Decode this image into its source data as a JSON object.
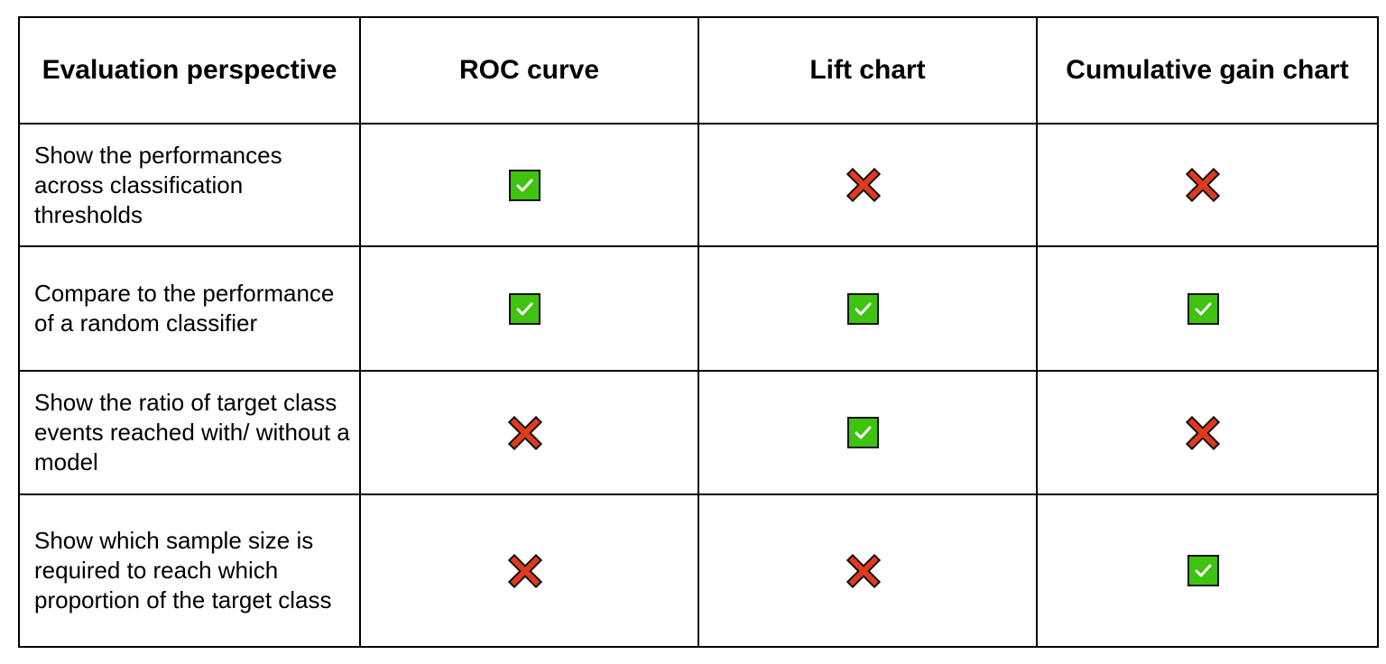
{
  "table": {
    "headers": [
      "Evaluation perspective",
      "ROC curve",
      "Lift chart",
      "Cumulative gain chart"
    ],
    "rows": [
      {
        "label": "Show the performances across classification thresholds",
        "values": [
          "check",
          "cross",
          "cross"
        ]
      },
      {
        "label": "Compare to the performance of a random classifier",
        "values": [
          "check",
          "check",
          "check"
        ]
      },
      {
        "label": "Show the ratio of target class events reached with/ without a model",
        "values": [
          "cross",
          "check",
          "cross"
        ]
      },
      {
        "label": "Show which sample size is required to reach which proportion of the target class",
        "values": [
          "cross",
          "cross",
          "check"
        ]
      }
    ]
  },
  "icons": {
    "check": {
      "name": "checkmark-icon",
      "fill": "#3ec30f",
      "mark": "#ffffff"
    },
    "cross": {
      "name": "cross-icon",
      "fill": "#e03a1e",
      "outline": "#111111"
    }
  }
}
